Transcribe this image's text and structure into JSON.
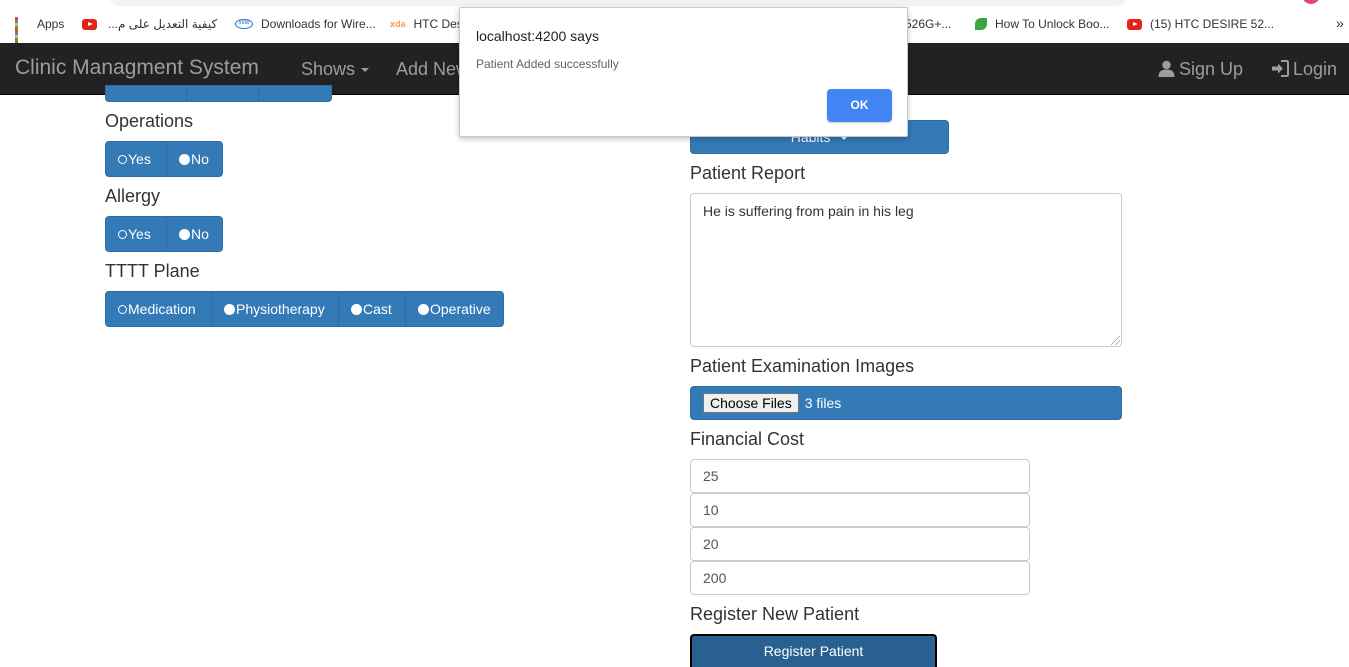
{
  "bookmarks": {
    "items": [
      {
        "label": "Apps",
        "icon": "apps-grid-icon"
      },
      {
        "label": "",
        "icon": "youtube-icon"
      },
      {
        "label": "كيفية التعديل على م...",
        "icon": "none"
      },
      {
        "label": "Downloads for Wire...",
        "icon": "intel-icon"
      },
      {
        "label": "HTC Des",
        "icon": "xda-icon"
      },
      {
        "label": "526G+...",
        "icon": "none"
      },
      {
        "label": "How To Unlock Boo...",
        "icon": "leaf-icon"
      },
      {
        "label": "(15) HTC DESIRE 52...",
        "icon": "youtube-icon"
      }
    ],
    "more": "»"
  },
  "navbar": {
    "brand": "Clinic Managment System",
    "shows": "Shows",
    "add_new": "Add New",
    "sign_up": "Sign Up",
    "login": "Login"
  },
  "form": {
    "operations": {
      "label": "Operations",
      "options": [
        "Yes",
        "No"
      ]
    },
    "allergy": {
      "label": "Allergy",
      "options": [
        "Yes",
        "No"
      ]
    },
    "treatment_plan": {
      "label": "TTTT Plane",
      "options": [
        "Medication",
        "Physiotherapy",
        "Cast",
        "Operative"
      ]
    },
    "habits_label": "Habits",
    "patient_report": {
      "label": "Patient Report",
      "value": "He is suffering from pain in his leg"
    },
    "examination_images": {
      "label": "Patient Examination Images",
      "button": "Choose Files",
      "status": "3 files"
    },
    "financial_cost": {
      "label": "Financial Cost",
      "values": [
        "25",
        "10",
        "20",
        "200"
      ]
    },
    "register": {
      "label": "Register New Patient",
      "button": "Register Patient"
    }
  },
  "dialog": {
    "title": "localhost:4200 says",
    "message": "Patient Added successfully",
    "ok": "OK"
  },
  "colors": {
    "primary": "#337ab7",
    "navbar": "#222222",
    "dialog_button": "#4285f4"
  }
}
